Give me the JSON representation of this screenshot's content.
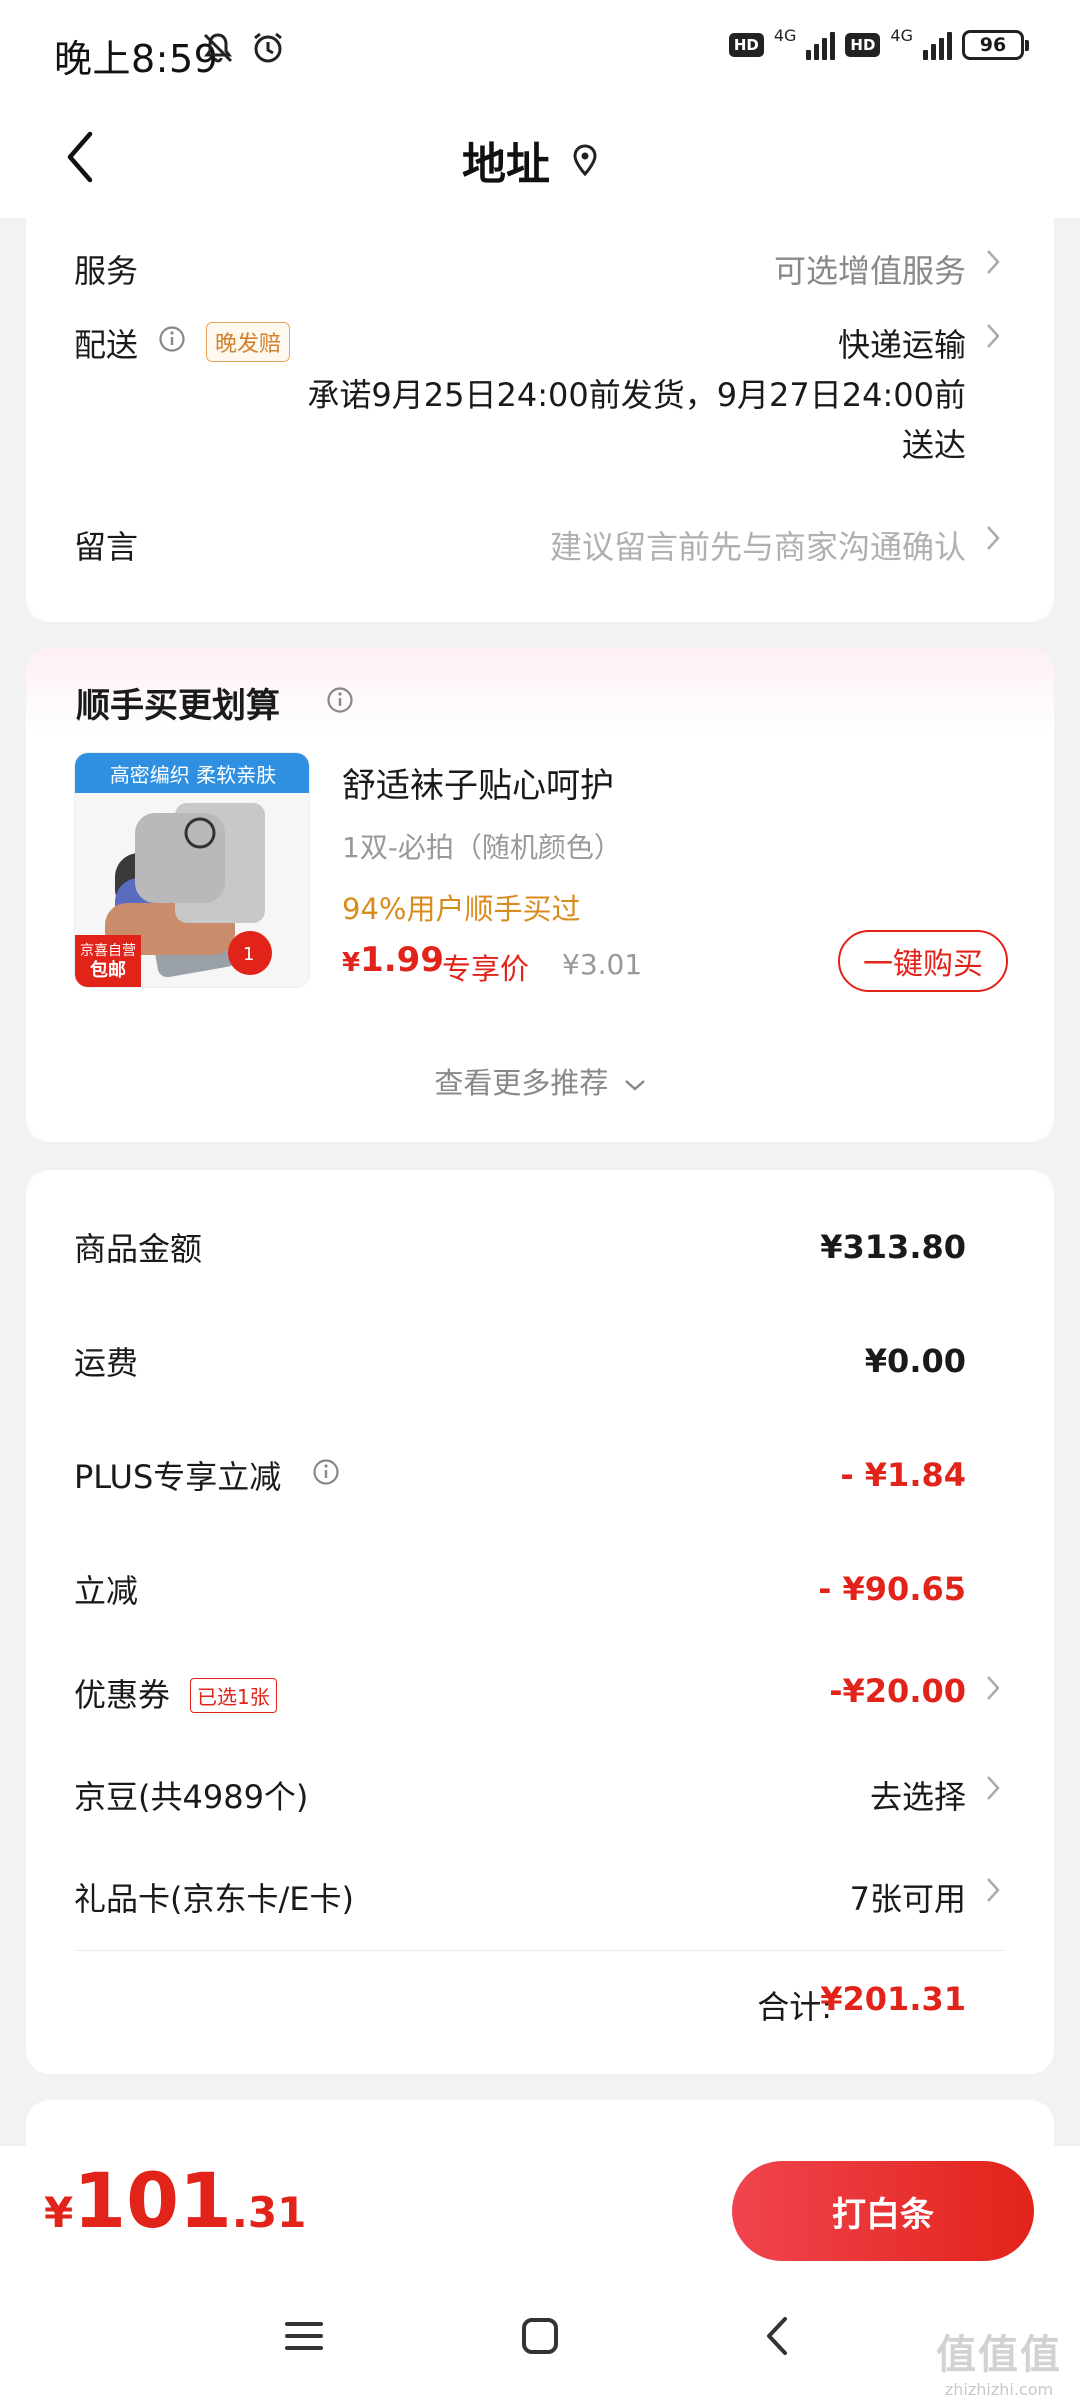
{
  "status_bar": {
    "time": "晚上8:59",
    "hd1": "HD",
    "net1": "4G",
    "hd2": "HD",
    "net2": "4G",
    "battery": "96"
  },
  "header": {
    "title": "地址"
  },
  "order_info": {
    "service_label": "服务",
    "service_value": "可选增值服务",
    "delivery_label": "配送",
    "late_badge": "晚发赔",
    "delivery_value": "快递运输",
    "delivery_promise": "承诺9月25日24:00前发货，9月27日24:00前送达",
    "message_label": "留言",
    "message_placeholder": "建议留言前先与商家沟通确认"
  },
  "recommend": {
    "title": "顺手买更划算",
    "image_banner": "高密编织 柔软亲肤",
    "image_tag_line1": "京喜自营",
    "image_tag_line2": "包邮",
    "product_name": "舒适袜子贴心呵护",
    "product_spec": "1双-必拍（随机颜色）",
    "social_proof": "94%用户顺手买过",
    "price_symbol": "¥",
    "price": "1.99",
    "price_tag": "专享价",
    "original_price": "¥3.01",
    "buy_button": "一键购买",
    "more_link": "查看更多推荐"
  },
  "summary": {
    "goods_label": "商品金额",
    "goods_value": "¥313.80",
    "shipping_label": "运费",
    "shipping_value": "¥0.00",
    "plus_label": "PLUS专享立减",
    "plus_value": "- ¥1.84",
    "discount_label": "立减",
    "discount_value": "- ¥90.65",
    "coupon_label": "优惠券",
    "coupon_badge": "已选1张",
    "coupon_value": "-¥20.00",
    "jingdou_label": "京豆(共4989个)",
    "jingdou_value": "去选择",
    "giftcard_label": "礼品卡(京东卡/E卡)",
    "giftcard_value": "7张可用",
    "total_label": "合计:",
    "total_value": "¥201.31"
  },
  "bottom": {
    "price_symbol": "¥",
    "price_int": "101",
    "price_dec": ".31",
    "pay_button": "打白条"
  },
  "watermark": {
    "main": "值值值",
    "sub": "zhizhizhi.com"
  },
  "colors": {
    "accent": "#e2231a",
    "orange": "#d98c1e",
    "text": "#1a1a1a",
    "secondary": "#888888"
  }
}
